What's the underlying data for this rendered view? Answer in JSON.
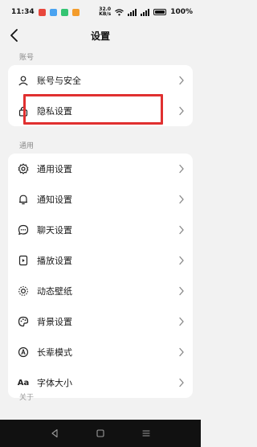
{
  "status_bar": {
    "time": "11:34",
    "speed_value": "32.0",
    "speed_unit": "KB/s",
    "battery": "100%"
  },
  "header": {
    "title": "设置"
  },
  "sections": {
    "account": {
      "label": "账号",
      "items": [
        {
          "label": "账号与安全",
          "icon": "user-icon"
        },
        {
          "label": "隐私设置",
          "icon": "lock-icon"
        }
      ]
    },
    "general": {
      "label": "通用",
      "items": [
        {
          "label": "通用设置",
          "icon": "gear-icon"
        },
        {
          "label": "通知设置",
          "icon": "bell-icon"
        },
        {
          "label": "聊天设置",
          "icon": "chat-bubble-icon"
        },
        {
          "label": "播放设置",
          "icon": "play-icon"
        },
        {
          "label": "动态壁纸",
          "icon": "wallpaper-icon"
        },
        {
          "label": "背景设置",
          "icon": "palette-icon"
        },
        {
          "label": "长辈模式",
          "icon": "elder-mode-icon"
        },
        {
          "label": "字体大小",
          "icon": "font-size-icon",
          "glyph": "Aa"
        }
      ]
    },
    "about": {
      "label": "关于"
    }
  },
  "colors": {
    "background": "#f2f2f2",
    "card": "#ffffff",
    "highlight": "#e03030",
    "section_label": "#8a8a8a"
  }
}
